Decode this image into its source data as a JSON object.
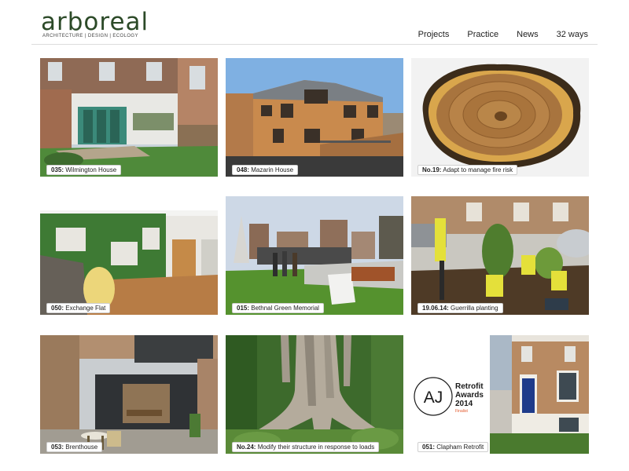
{
  "logo": {
    "name": "arboreal",
    "tagline": "ARCHITECTURE | DESIGN | ECOLOGY"
  },
  "nav": [
    {
      "label": "Projects"
    },
    {
      "label": "Practice"
    },
    {
      "label": "News"
    },
    {
      "label": "32 ways"
    }
  ],
  "tiles": [
    {
      "code": "035:",
      "title": "Wilmington House"
    },
    {
      "code": "048:",
      "title": "Mazarin House"
    },
    {
      "code": "No.19:",
      "title": "Adapt to manage fire risk"
    },
    {
      "code": "050:",
      "title": "Exchange Flat"
    },
    {
      "code": "015:",
      "title": "Bethnal Green Memorial"
    },
    {
      "code": "19.06.14:",
      "title": "Guerrilla planting"
    },
    {
      "code": "053:",
      "title": "Brenthouse"
    },
    {
      "code": "No.24:",
      "title": "Modify their structure in response to loads"
    },
    {
      "code": "051:",
      "title": "Clapham Retrofit"
    }
  ],
  "award": {
    "mark": "AJ",
    "line1": "Retrofit",
    "line2": "Awards",
    "line3": "2014",
    "line4": "Finalist"
  }
}
